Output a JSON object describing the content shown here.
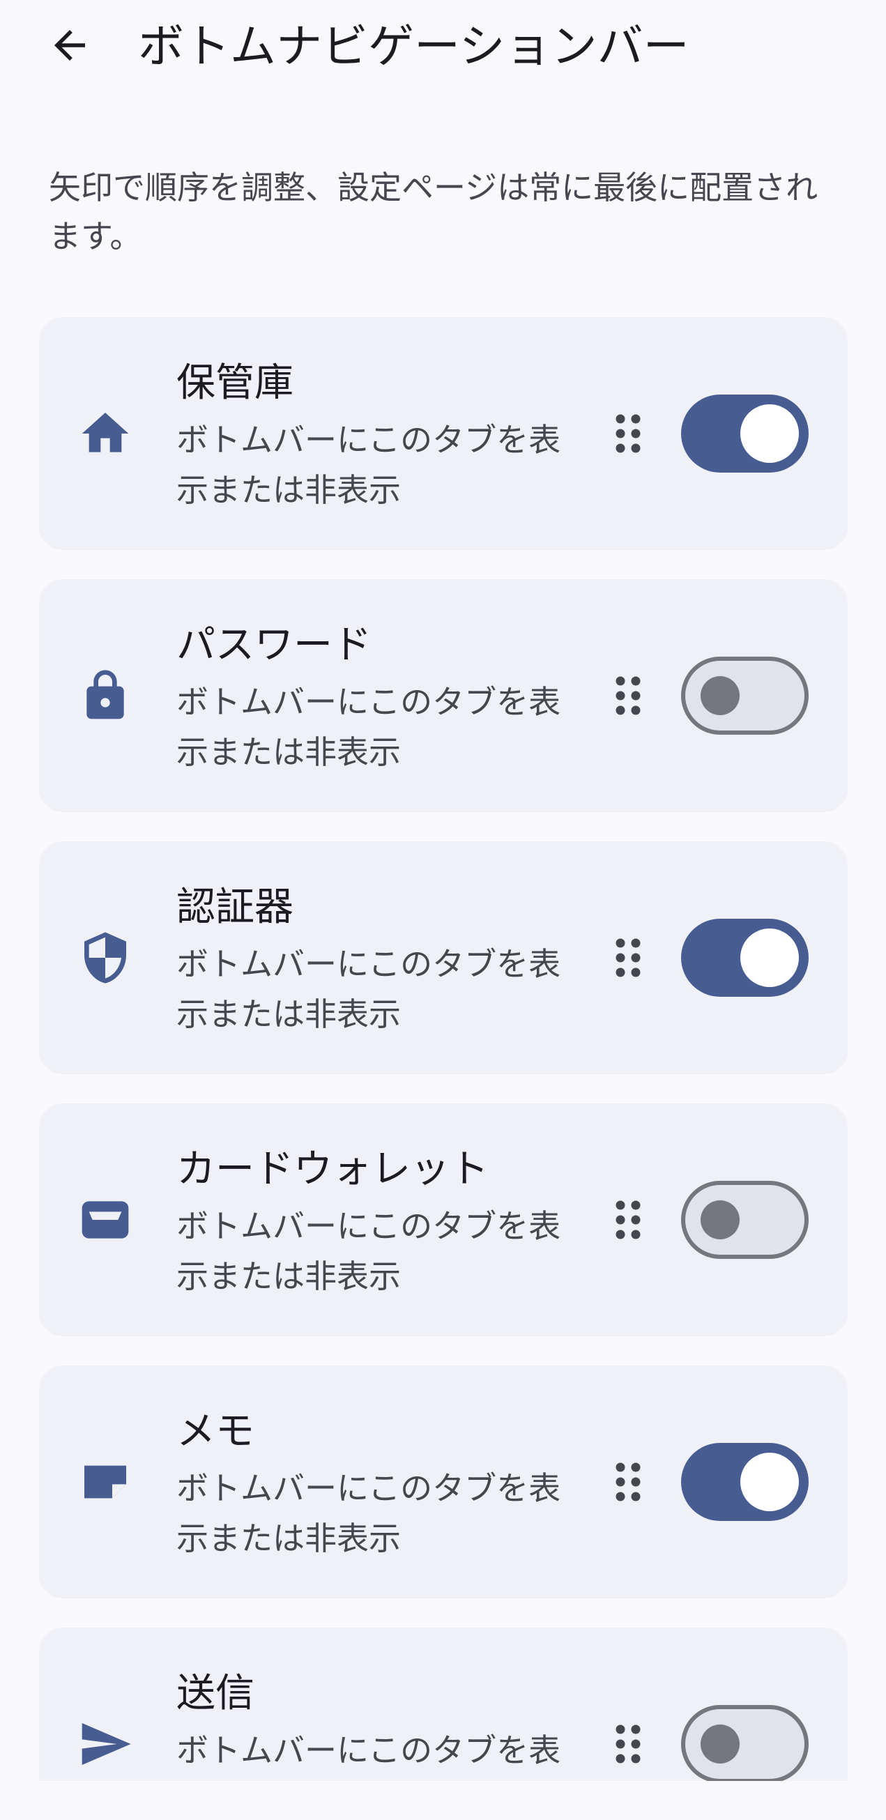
{
  "app_bar": {
    "title": "ボトムナビゲーションバー",
    "back_icon": "arrow-back-icon"
  },
  "description": "矢印で順序を調整、設定ページは常に最後に配置されます。",
  "colors": {
    "accent": "#475d92",
    "card_background": "#f0f0f7",
    "page_background": "#f8f8fd",
    "switch_off_border": "#75777f"
  },
  "items": [
    {
      "title": "保管庫",
      "subtitle": "ボトムバーにこのタブを表示または非表示",
      "icon": "home-icon",
      "enabled": true
    },
    {
      "title": "パスワード",
      "subtitle": "ボトムバーにこのタブを表示または非表示",
      "icon": "lock-icon",
      "enabled": false
    },
    {
      "title": "認証器",
      "subtitle": "ボトムバーにこのタブを表示または非表示",
      "icon": "shield-icon",
      "enabled": true
    },
    {
      "title": "カードウォレット",
      "subtitle": "ボトムバーにこのタブを表示または非表示",
      "icon": "wallet-icon",
      "enabled": false
    },
    {
      "title": "メモ",
      "subtitle": "ボトムバーにこのタブを表示または非表示",
      "icon": "note-icon",
      "enabled": true
    },
    {
      "title": "送信",
      "subtitle": "ボトムバーにこのタブを表示または非表示",
      "icon": "send-icon",
      "enabled": false
    }
  ]
}
